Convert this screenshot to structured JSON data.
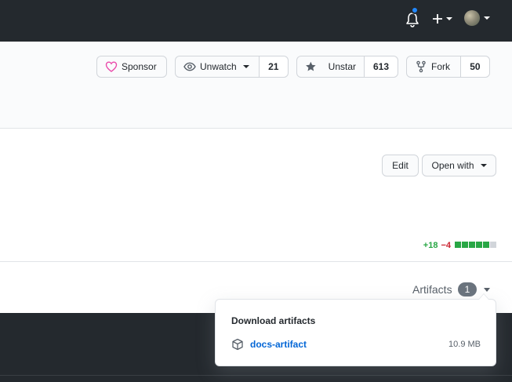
{
  "header": {
    "notifications_icon": "bell-icon",
    "create_icon": "plus-icon",
    "avatar_icon": "avatar"
  },
  "repo_actions": {
    "sponsor": {
      "label": "Sponsor"
    },
    "watch": {
      "label": "Unwatch",
      "count": "21"
    },
    "star": {
      "label": "Unstar",
      "count": "613"
    },
    "fork": {
      "label": "Fork",
      "count": "50"
    }
  },
  "file_toolbar": {
    "edit_label": "Edit",
    "open_with_label": "Open with"
  },
  "diffstat": {
    "additions": "+18",
    "deletions": "−4",
    "blocks": [
      "#28a745",
      "#28a745",
      "#28a745",
      "#28a745",
      "#28a745",
      "#d1d5da"
    ]
  },
  "artifacts": {
    "label": "Artifacts",
    "count": "1",
    "popover_title": "Download artifacts",
    "items": [
      {
        "name": "docs-artifact",
        "size": "10.9 MB"
      }
    ]
  },
  "colors": {
    "header_bg": "#24292e",
    "link": "#0366d6",
    "notification_dot": "#2188ff",
    "sponsor_heart": "#ea4aaa"
  }
}
